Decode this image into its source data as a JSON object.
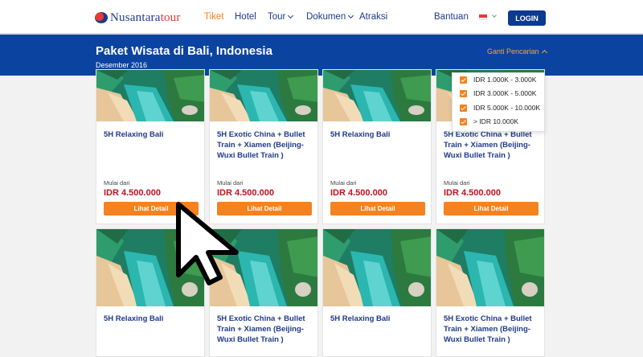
{
  "header": {
    "logo": {
      "part1": "Nusantara",
      "part2": "tour"
    },
    "nav": [
      {
        "label": "Tiket",
        "active": true
      },
      {
        "label": "Hotel"
      },
      {
        "label": "Tour",
        "dropdown": true
      },
      {
        "label": "Dokumen",
        "dropdown": true
      },
      {
        "label": "Atraksi"
      }
    ],
    "help_label": "Bantuan",
    "login_label": "LOGIN"
  },
  "banner": {
    "title": "Paket Wisata di Bali, Indonesia",
    "subtitle": "Desember 2016",
    "change_search_label": "Ganti Pencarian"
  },
  "price_filter": {
    "options": [
      {
        "label": "IDR 1.000K - 3.000K",
        "checked": true
      },
      {
        "label": "IDR 3.000K - 5.000K",
        "checked": true
      },
      {
        "label": "IDR 5.000K - 10.000K",
        "checked": true
      },
      {
        "label": "> IDR 10.000K",
        "checked": true
      }
    ]
  },
  "cards": [
    {
      "title": "5H Relaxing Bali",
      "from_label": "Mulai dari",
      "price": "IDR 4.500.000",
      "button": "Lihat Detail"
    },
    {
      "title": "5H Exotic China + Bullet Train + Xiamen (Beijing-Wuxi Bullet Train )",
      "from_label": "Mulai dari",
      "price": "IDR 4.500.000",
      "button": "Lihat Detail"
    },
    {
      "title": "5H Relaxing Bali",
      "from_label": "Mulai dari",
      "price": "IDR 4.500.000",
      "button": "Lihat Detail"
    },
    {
      "title": "5H Exotic China + Bullet Train + Xiamen (Beijing-Wuxi Bullet Train )",
      "from_label": "Mulai dari",
      "price": "IDR 4.500.000",
      "button": "Lihat Detail"
    },
    {
      "title": "5H Relaxing Bali"
    },
    {
      "title": "5H Exotic China + Bullet Train + Xiamen (Beijing-Wuxi Bullet Train )"
    },
    {
      "title": "5H Relaxing Bali"
    },
    {
      "title": "5H Exotic China + Bullet Train + Xiamen (Beijing-Wuxi Bullet Train )"
    }
  ],
  "colors": {
    "brand_blue": "#0b44a0",
    "accent_orange": "#f5821f",
    "price_red": "#c1121f"
  },
  "icons": [
    "chevron-down-icon",
    "chevron-up-icon",
    "flag-icon",
    "checkbox-checked-icon",
    "mouse-pointer-icon"
  ]
}
